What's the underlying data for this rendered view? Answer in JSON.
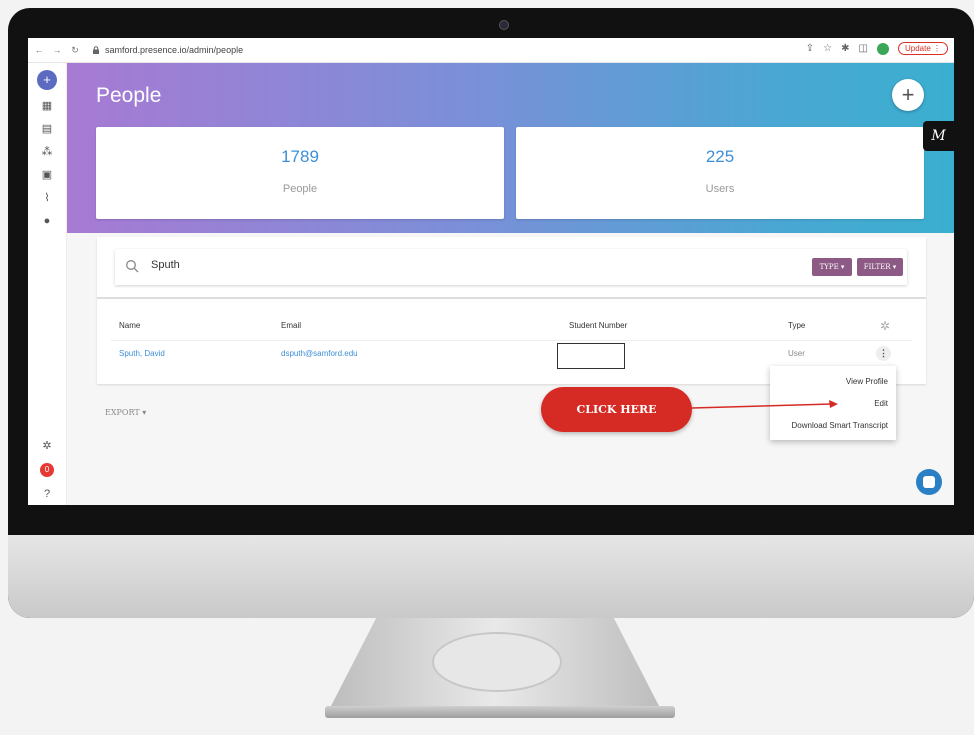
{
  "browser": {
    "url": "samford.presence.io/admin/people",
    "update_label": "Update",
    "profile_initial": "F"
  },
  "sidebar": {
    "icons": [
      "add-icon",
      "dashboard-icon",
      "document-icon",
      "group-icon",
      "calendar-icon",
      "analytics-icon",
      "person-icon",
      "settings-icon",
      "notification-icon",
      "help-icon"
    ],
    "notification_count": "0"
  },
  "page": {
    "title": "People",
    "add_button": "+"
  },
  "stats": [
    {
      "value": "1789",
      "label": "People"
    },
    {
      "value": "225",
      "label": "Users"
    }
  ],
  "search": {
    "value": "Sputh",
    "type_label": "TYPE ▾",
    "filter_label": "FILTER ▾"
  },
  "table": {
    "columns": [
      "Name",
      "Email",
      "Student Number",
      "Type"
    ],
    "rows": [
      {
        "name": "Sputh, David",
        "email": "dsputh@samford.edu",
        "student_number": "",
        "type": "User"
      }
    ]
  },
  "export_label": "EXPORT ▾",
  "row_menu": {
    "items": [
      "View Profile",
      "Edit",
      "Download Smart Transcript"
    ]
  },
  "badge": {
    "label": "M"
  },
  "annotation": {
    "label": "CLICK HERE"
  },
  "colors": {
    "brand": "#3d8fd8",
    "accent": "#8d5a86",
    "callout": "#d52b24"
  }
}
